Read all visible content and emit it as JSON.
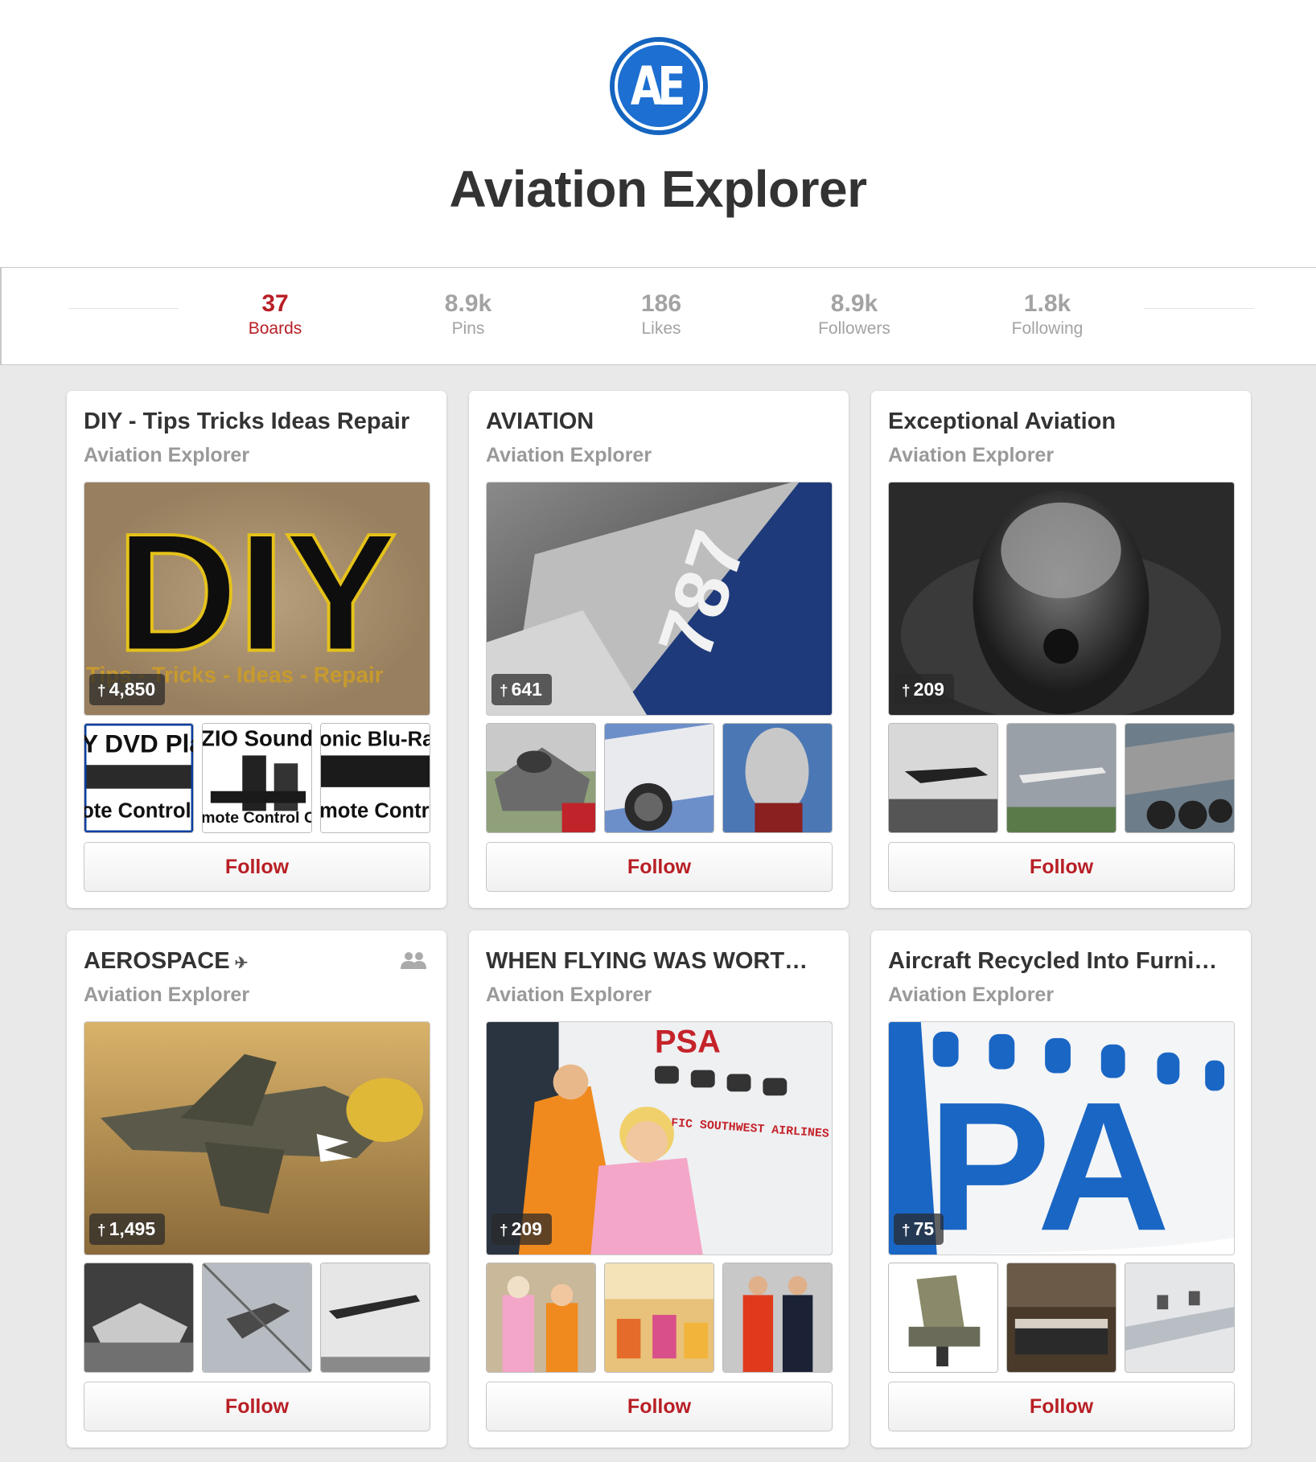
{
  "profile": {
    "avatar_text": "AE",
    "name": "Aviation Explorer"
  },
  "stats": [
    {
      "value": "37",
      "label": "Boards",
      "active": true
    },
    {
      "value": "8.9k",
      "label": "Pins"
    },
    {
      "value": "186",
      "label": "Likes"
    },
    {
      "value": "8.9k",
      "label": "Followers"
    },
    {
      "value": "1.8k",
      "label": "Following"
    }
  ],
  "boards": [
    {
      "title": "DIY - Tips Tricks Ideas Repair",
      "owner": "Aviation Explorer",
      "pin_count": "4,850",
      "follow_label": "Follow",
      "cover_text": "DIY",
      "cover_subtext": "Tips - Tricks - Ideas - Repair",
      "thumb_texts": [
        [
          "Y DVD Pla",
          "ote Control C"
        ],
        [
          "ZIO Sound Ba",
          "mote Control Co"
        ],
        [
          "onic Blu-Ray",
          "mote Control"
        ]
      ]
    },
    {
      "title": "AVIATION",
      "owner": "Aviation Explorer",
      "pin_count": "641",
      "follow_label": "Follow",
      "cover_text": "787"
    },
    {
      "title": "Exceptional Aviation",
      "owner": "Aviation Explorer",
      "pin_count": "209",
      "follow_label": "Follow"
    },
    {
      "title": "AEROSPACE",
      "title_mark": "✈",
      "collaborative": true,
      "owner": "Aviation Explorer",
      "pin_count": "1,495",
      "follow_label": "Follow"
    },
    {
      "title": "WHEN FLYING WAS WORT…",
      "owner": "Aviation Explorer",
      "pin_count": "209",
      "follow_label": "Follow",
      "cover_text": "PSA",
      "cover_subtext": "FIC SOUTHWEST AIRLINES"
    },
    {
      "title": "Aircraft Recycled Into Furni…",
      "owner": "Aviation Explorer",
      "pin_count": "75",
      "follow_label": "Follow",
      "cover_text": "PA"
    }
  ],
  "colors": {
    "accent_red": "#b81f25",
    "brand_blue": "#1d6fd1",
    "muted_gray": "#999999",
    "page_bg": "#e9e9e9"
  },
  "icons": {
    "pin": "pushpin-icon",
    "collaborators": "group-icon",
    "plane": "airplane-icon"
  }
}
